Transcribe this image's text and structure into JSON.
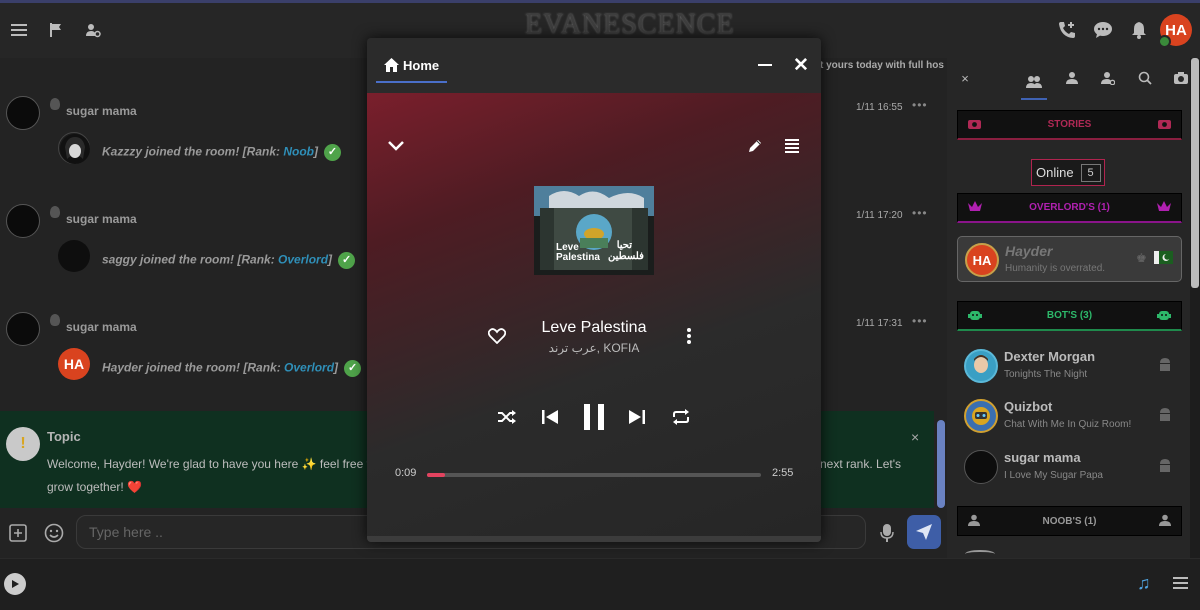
{
  "topbar": {
    "logo": "EVANESCENCE",
    "user_initials": "HA"
  },
  "chat": {
    "hint_text": "t yours today with full hos",
    "messages": [
      {
        "user": "sugar mama",
        "time": "1/11 16:55",
        "more": "•••",
        "joined_name": "Kazzzy",
        "joined_text": " joined the room! [Rank: ",
        "rank": "Noob",
        "close": "]"
      },
      {
        "user": "sugar mama",
        "time": "1/11 17:20",
        "more": "•••",
        "joined_name": "saggy",
        "joined_text": " joined the room! [Rank: ",
        "rank": "Overlord",
        "close": "]"
      },
      {
        "user": "sugar mama",
        "time": "1/11 17:31",
        "more": "•••",
        "joined_name": "Hayder",
        "joined_text": " joined the room! [Rank: ",
        "rank": "Overlord",
        "close": "]",
        "avatar_initials": "HA"
      }
    ]
  },
  "topic": {
    "title": "Topic",
    "text_a": "Welcome, Hayder! We're glad to have you here ✨ feel free t",
    "text_b": "next rank. Let's",
    "text_c": "grow together! ❤️",
    "close": "×"
  },
  "composer": {
    "placeholder": "Type here .."
  },
  "sidebar": {
    "close": "×",
    "stories_label": "STORIES",
    "online_label": "Online",
    "online_count": "5",
    "overlords_label": "OVERLORD'S (1)",
    "bots_label": "BOT'S (3)",
    "noobs_label": "NOOB'S (1)",
    "overlords": [
      {
        "name": "Hayder",
        "mood": "Humanity is overrated.",
        "initials": "HA"
      }
    ],
    "bots": [
      {
        "name": "Dexter Morgan",
        "mood": "Tonights The Night"
      },
      {
        "name": "Quizbot",
        "mood": "Chat With Me In Quiz Room!"
      },
      {
        "name": "sugar mama",
        "mood": "I Love My Sugar Papa"
      }
    ]
  },
  "player": {
    "home_tab": "Home",
    "track_title": "Leve Palestina",
    "track_artist": "عرب ترند, KOFIA",
    "cover_text_left": "Leve\nPalestina",
    "cover_text_right": "تحيا\nفلسطين",
    "current_time": "0:09",
    "total_time": "2:55",
    "progress_fraction": 0.055
  },
  "colors": {
    "accent": "#3e5ea7",
    "progress": "#e3435f",
    "overlord": "#b020b0",
    "bots": "#2db86a",
    "stories": "#b02955"
  }
}
